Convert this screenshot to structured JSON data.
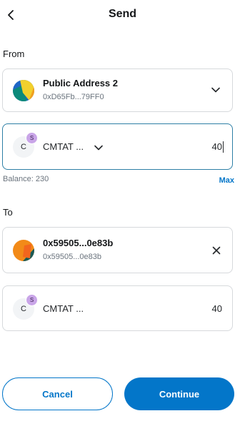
{
  "header": {
    "title": "Send"
  },
  "from": {
    "label": "From",
    "account": {
      "name": "Public Address 2",
      "address": "0xD65Fb...79FF0"
    },
    "token": {
      "symbol": "CMTAT ...",
      "icon_letter": "C",
      "badge_letter": "S",
      "amount": "40"
    },
    "balance": "Balance: 230",
    "max_label": "Max"
  },
  "to": {
    "label": "To",
    "recipient": {
      "name": "0x59505...0e83b",
      "address": "0x59505...0e83b"
    },
    "token": {
      "symbol": "CMTAT ...",
      "icon_letter": "C",
      "badge_letter": "S",
      "amount": "40"
    }
  },
  "footer": {
    "cancel_label": "Cancel",
    "continue_label": "Continue"
  },
  "colors": {
    "primary": "#0376c9",
    "border": "#d6d9dc",
    "focus_border": "#2d7fa6",
    "badge": "#c9a5e8"
  }
}
